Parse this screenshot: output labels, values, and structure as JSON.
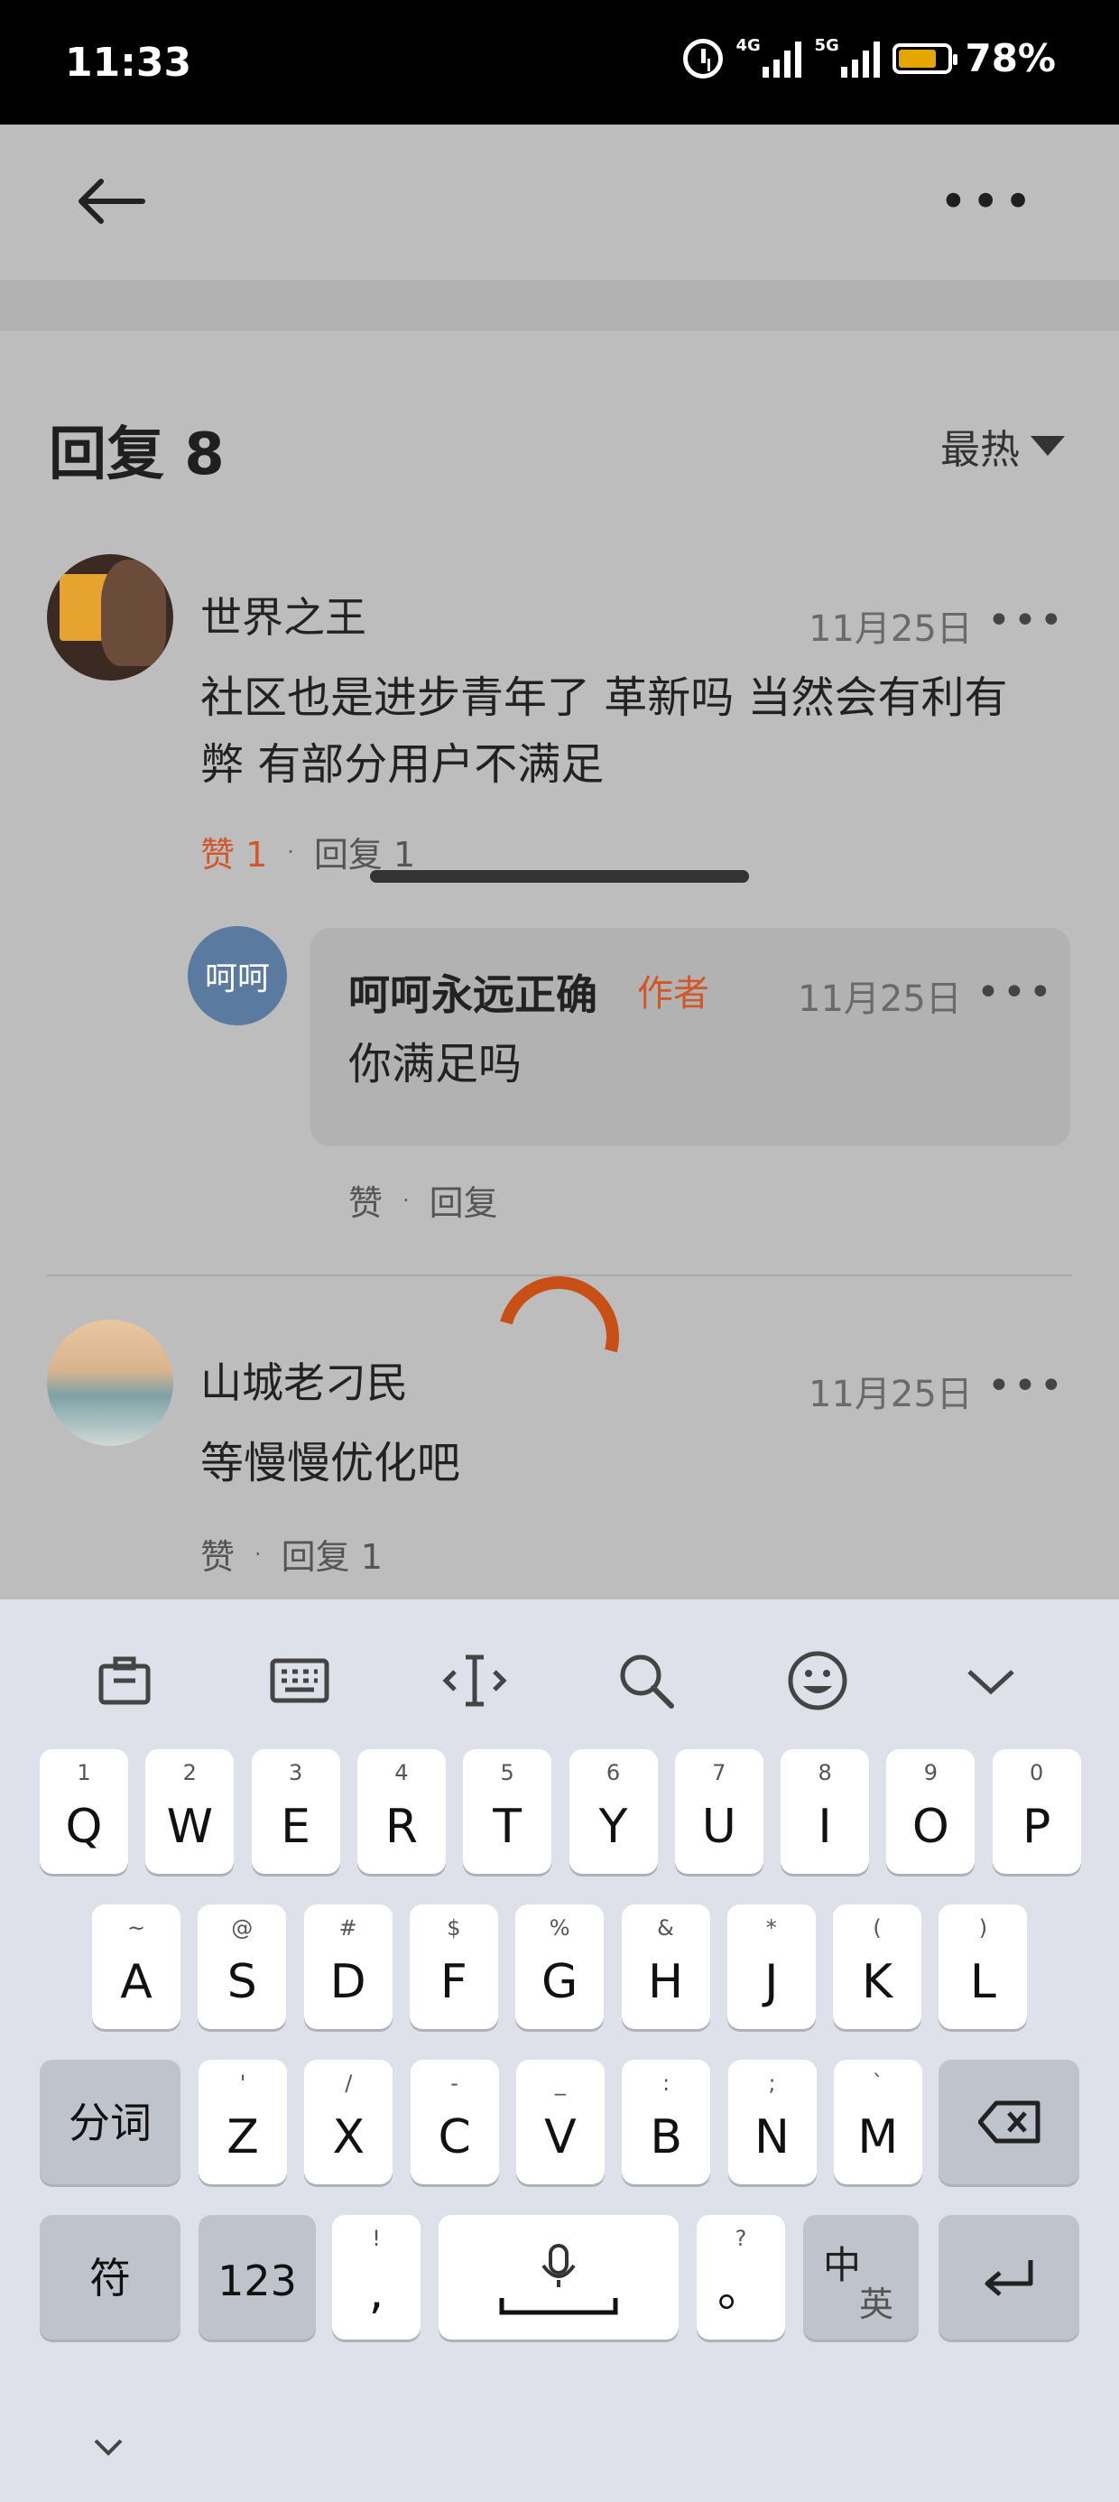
{
  "status": {
    "time": "11:33",
    "net1": "4G",
    "net2": "5G",
    "battery": "78%"
  },
  "header": {
    "title": "回复 8",
    "sort_label": "最热"
  },
  "comments": [
    {
      "user": "世界之王",
      "date": "11月25日",
      "text": "社区也是进步青年了 革新吗 当然会有利有弊 有部分用户不满足",
      "like_label": "赞 1",
      "reply_label": "回复 1",
      "reply": {
        "avatar_text": "呵呵",
        "user": "呵呵永远正确",
        "tag": "作者",
        "date": "11月25日",
        "text": "你满足吗",
        "like_label": "赞",
        "reply_label": "回复"
      }
    },
    {
      "user": "山城老刁民",
      "date": "11月25日",
      "text": "等慢慢优化吧",
      "like_label": "赞",
      "reply_label": "回复 1"
    }
  ],
  "keyboard": {
    "row1": [
      {
        "k": "Q",
        "s": "1"
      },
      {
        "k": "W",
        "s": "2"
      },
      {
        "k": "E",
        "s": "3"
      },
      {
        "k": "R",
        "s": "4"
      },
      {
        "k": "T",
        "s": "5"
      },
      {
        "k": "Y",
        "s": "6"
      },
      {
        "k": "U",
        "s": "7"
      },
      {
        "k": "I",
        "s": "8"
      },
      {
        "k": "O",
        "s": "9"
      },
      {
        "k": "P",
        "s": "0"
      }
    ],
    "row2": [
      {
        "k": "A",
        "s": "~"
      },
      {
        "k": "S",
        "s": "@"
      },
      {
        "k": "D",
        "s": "#"
      },
      {
        "k": "F",
        "s": "$"
      },
      {
        "k": "G",
        "s": "%"
      },
      {
        "k": "H",
        "s": "&"
      },
      {
        "k": "J",
        "s": "*"
      },
      {
        "k": "K",
        "s": "("
      },
      {
        "k": "L",
        "s": ")"
      }
    ],
    "row3": [
      {
        "k": "Z",
        "s": "'"
      },
      {
        "k": "X",
        "s": "/"
      },
      {
        "k": "C",
        "s": "-"
      },
      {
        "k": "V",
        "s": "_"
      },
      {
        "k": "B",
        "s": ":"
      },
      {
        "k": "N",
        "s": ";"
      },
      {
        "k": "M",
        "s": "`"
      }
    ],
    "segment_label": "分词",
    "symbol_label": "符",
    "num_label": "123",
    "comma": {
      "k": ",",
      "s": "!"
    },
    "period": {
      "k": "。",
      "s": "?"
    },
    "lang_top": "中",
    "lang_bottom": "英"
  }
}
